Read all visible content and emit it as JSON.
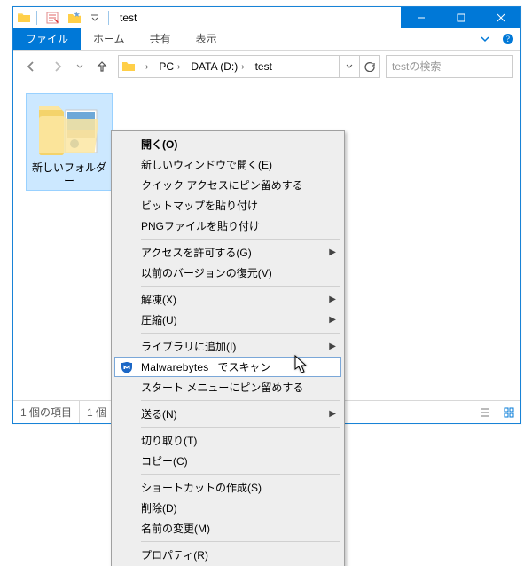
{
  "titlebar": {
    "title": "test",
    "minimize": "—",
    "maximize": "☐",
    "close": "✕"
  },
  "tabs": {
    "file": "ファイル",
    "home": "ホーム",
    "share": "共有",
    "view": "表示"
  },
  "breadcrumb": {
    "pc": "PC",
    "drive": "DATA (D:)",
    "folder": "test"
  },
  "search": {
    "placeholder": "testの検索"
  },
  "item": {
    "label": "新しいフォルダー"
  },
  "status": {
    "count": "1 個の項目",
    "selected_prefix": "1 個"
  },
  "context_menu": {
    "open": "開く(O)",
    "open_new_window": "新しいウィンドウで開く(E)",
    "pin_quick_access": "クイック アクセスにピン留めする",
    "paste_bitmap": "ビットマップを貼り付け",
    "paste_png": "PNGファイルを貼り付け",
    "grant_access": "アクセスを許可する(G)",
    "restore_versions": "以前のバージョンの復元(V)",
    "extract": "解凍(X)",
    "compress": "圧縮(U)",
    "add_to_library": "ライブラリに追加(I)",
    "malwarebytes_brand": "Malwarebytes",
    "malwarebytes_action": "でスキャン",
    "pin_start": "スタート メニューにピン留めする",
    "send_to": "送る(N)",
    "cut": "切り取り(T)",
    "copy": "コピー(C)",
    "create_shortcut": "ショートカットの作成(S)",
    "delete": "削除(D)",
    "rename": "名前の変更(M)",
    "properties": "プロパティ(R)"
  }
}
